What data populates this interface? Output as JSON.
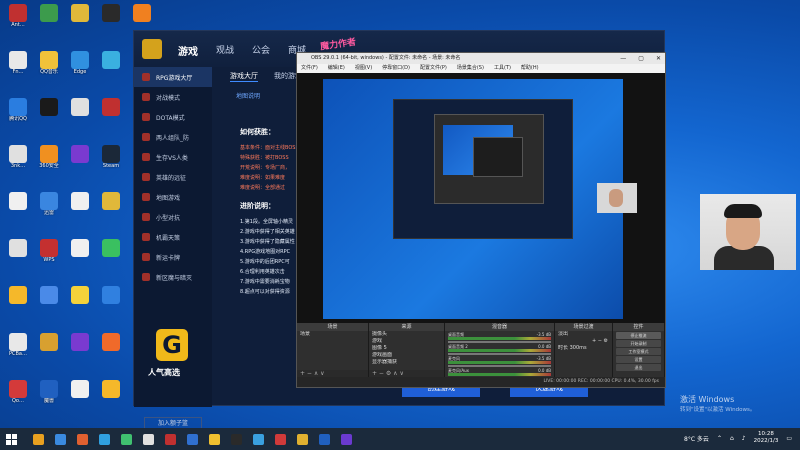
{
  "desktop": {
    "icons": [
      {
        "label": "Ant…",
        "color": "#c03030"
      },
      {
        "label": "Fn…",
        "color": "#e8e8e8"
      },
      {
        "label": "腾讯QQ",
        "color": "#2a7de0"
      },
      {
        "label": "3nk…",
        "color": "#e0e0e0"
      },
      {
        "label": "",
        "color": "#f0f0f0"
      },
      {
        "label": "",
        "color": "#e0e0e0"
      },
      {
        "label": "",
        "color": "#f5b82a"
      },
      {
        "label": "PCBa…",
        "color": "#e8e8e8"
      },
      {
        "label": "Qo…",
        "color": "#d43a3a"
      },
      {
        "label": "",
        "color": "#3c9b4c"
      },
      {
        "label": "QQ音乐",
        "color": "#f0c23a"
      },
      {
        "label": "",
        "color": "#1a1a1a"
      },
      {
        "label": "360安全",
        "color": "#f09020"
      },
      {
        "label": "迅雷",
        "color": "#3a86e0"
      },
      {
        "label": "WPS",
        "color": "#c43030"
      },
      {
        "label": "",
        "color": "#4a8ae8"
      },
      {
        "label": "",
        "color": "#d8a030"
      },
      {
        "label": "魔兽",
        "color": "#2060c0"
      },
      {
        "label": "",
        "color": "#e0b83a"
      },
      {
        "label": "Edge",
        "color": "#3090e0"
      },
      {
        "label": "",
        "color": "#e0e0e0"
      },
      {
        "label": "",
        "color": "#7a3ad0"
      },
      {
        "label": "",
        "color": "#f0f0f0"
      },
      {
        "label": "",
        "color": "#f0f0f0"
      },
      {
        "label": "",
        "color": "#f5d23a"
      },
      {
        "label": "",
        "color": "#7a3ad0"
      },
      {
        "label": "",
        "color": "#f0f0f0"
      },
      {
        "label": "",
        "color": "#2a2a2a"
      },
      {
        "label": "",
        "color": "#3ab0e0"
      },
      {
        "label": "",
        "color": "#c03030"
      },
      {
        "label": "Steam",
        "color": "#1b2838"
      },
      {
        "label": "",
        "color": "#e0b83a"
      },
      {
        "label": "",
        "color": "#3ac060"
      },
      {
        "label": "",
        "color": "#3080e0"
      },
      {
        "label": "",
        "color": "#f06a2a"
      },
      {
        "label": "",
        "color": "#f5b82a"
      },
      {
        "label": "",
        "color": "#f08020"
      },
      {
        "label": "",
        "color": "#e0e0e0"
      },
      {
        "label": "",
        "color": "#3ab0a0"
      },
      {
        "label": "",
        "color": "#e0e0e0"
      },
      {
        "label": "",
        "color": "#c03a2a"
      },
      {
        "label": "",
        "color": "#2a2a2a"
      },
      {
        "label": "",
        "color": "#3080e0"
      },
      {
        "label": "",
        "color": "#f0f0f0"
      }
    ]
  },
  "launcher": {
    "nav": [
      "游戏",
      "观战",
      "公会",
      "商城"
    ],
    "promo": "魔力作者",
    "sidebar": [
      "RPG游戏大厅",
      "对战模式",
      "DOTA模式",
      "两人组队_防",
      "生存VS人类",
      "英雄的远征",
      "地图游戏",
      "小型对抗",
      "机霸天策",
      "新运卡牌",
      "新区魔与暗灭"
    ],
    "subtabs": [
      "游戏大厅",
      "我的游戏"
    ],
    "sub_link": "地图说明",
    "how_title": "如何获胜：",
    "how_lines": [
      "基本条件：面对主线BOSS",
      "特殊获胜：被打BOSS",
      "开荒说明：专场厂商，",
      "难度说明：如果难度",
      "难度说明：全部通过"
    ],
    "advance_title": "进阶说明：",
    "advance_lines": [
      "1.第1段。全屏轴小精灵",
      "2.游戏中获得了相关英雄",
      "3.游戏中获得了隐藏属性",
      "4.RPG游戏地图对RPC",
      "5.游戏中的后团RPC可",
      "6.合理利用英雄次击",
      "7.游戏中需要消耗宝物",
      "8.超点可以对获得资源"
    ],
    "brand": "人气高选",
    "join": "加入额子篮",
    "create_btn": "创建游戏",
    "quick_btn": "快速游戏"
  },
  "obs": {
    "title": "OBS 29.0.1 (64-bit, windows) - 配置文件: 未命名 - 场景: 未命名",
    "menu": [
      "文件(F)",
      "编辑(E)",
      "视图(V)",
      "停靠窗口(D)",
      "配置文件(P)",
      "场景集合(S)",
      "工具(T)",
      "帮助(H)"
    ],
    "scenes_header": "场景",
    "scenes": [
      "场景"
    ],
    "sources_header": "来源",
    "sources": [
      "摄像头",
      "游戏",
      "图像 5",
      "游戏画面",
      "显示器捕获"
    ],
    "mixer_header": "混音器",
    "mixer": [
      {
        "name": "桌面音频",
        "level": "-3.5 dB"
      },
      {
        "name": "桌面音频 2",
        "level": "0.0 dB"
      },
      {
        "name": "麦克风",
        "level": "-3.5 dB"
      },
      {
        "name": "麦克风/Aux",
        "level": "0.0 dB"
      }
    ],
    "transitions_header": "场景过渡",
    "transition_value": "淡出",
    "duration_label": "时长",
    "duration_value": "300ms",
    "controls_header": "控件",
    "controls": [
      "停止推流",
      "开始录制",
      "工作室模式",
      "设置",
      "退出"
    ],
    "status": "LIVE: 00:00:00   REC: 00:00:00   CPU: 0.4%, 30.00 fps"
  },
  "activate": {
    "line1": "激活 Windows",
    "line2": "转到\"设置\"以激活 Windows。"
  },
  "taskbar": {
    "weather": "8°C 多云",
    "time": "10:28",
    "date": "2022/1/3",
    "icons": [
      "#e8a020",
      "#3a8ae0",
      "#e06030",
      "#30a0e0",
      "#40c070",
      "#e0e0e0",
      "#c03030",
      "#3070d0",
      "#f0c030",
      "#2a2a2a",
      "#3aa0e0",
      "#d03a3a",
      "#e0b030",
      "#2060c0",
      "#6a3ad0"
    ]
  }
}
